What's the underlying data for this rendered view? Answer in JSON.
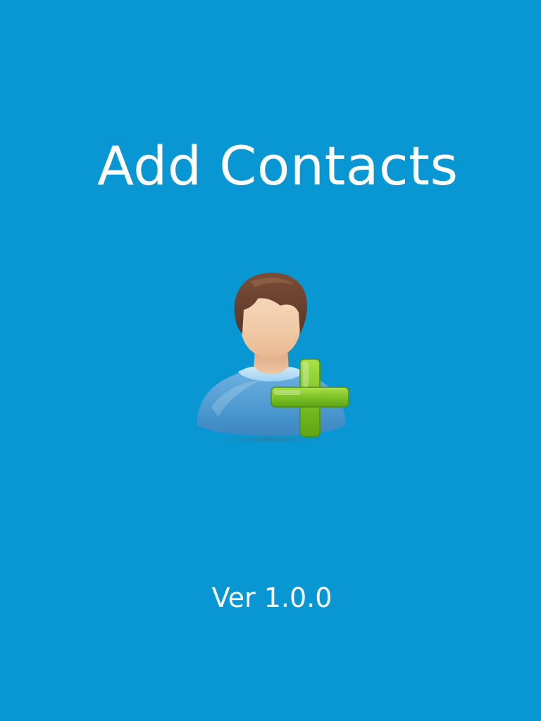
{
  "splash": {
    "title": "Add Contacts",
    "version": "Ver 1.0.0",
    "icon": "add-contact-icon"
  },
  "colors": {
    "background": "#0897d3",
    "text": "#ffffff",
    "plus": "#7cc51f",
    "body": "#4a96cf",
    "hair": "#6b4330",
    "skin": "#f3d2b3"
  }
}
